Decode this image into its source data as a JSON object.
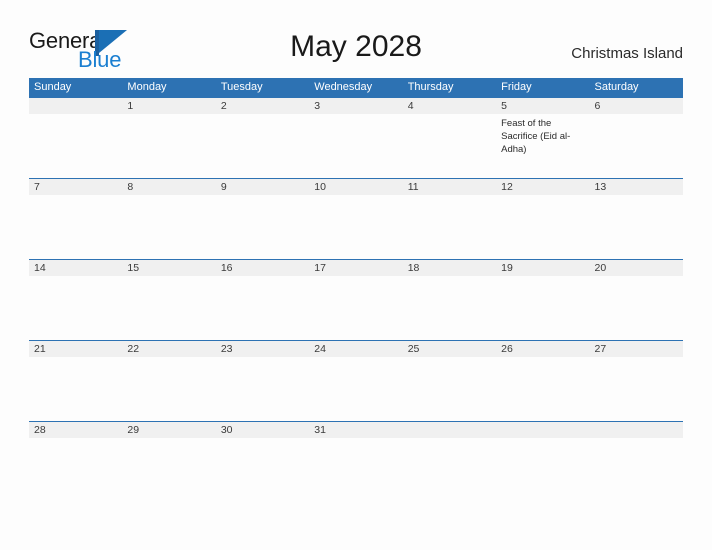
{
  "brand": {
    "name_part1": "General",
    "name_part2": "Blue",
    "mark": "triangle-flag-icon",
    "colors": {
      "dark_text": "#1a1a1a",
      "blue_text": "#1b7fd1",
      "bar": "#1b5f9e",
      "triangle": "#1b6fb5"
    }
  },
  "header": {
    "title": "May 2028",
    "location": "Christmas Island"
  },
  "calendar": {
    "colors": {
      "header_blue": "#2d72b3",
      "row_divider_blue": "#2d72b3",
      "date_strip_gray": "#f0f0f0",
      "page_background": "#fdfdfd"
    },
    "weekdays": [
      "Sunday",
      "Monday",
      "Tuesday",
      "Wednesday",
      "Thursday",
      "Friday",
      "Saturday"
    ],
    "weeks": [
      [
        {
          "date": "",
          "event": ""
        },
        {
          "date": "1",
          "event": ""
        },
        {
          "date": "2",
          "event": ""
        },
        {
          "date": "3",
          "event": ""
        },
        {
          "date": "4",
          "event": ""
        },
        {
          "date": "5",
          "event": "Feast of the Sacrifice (Eid al-Adha)"
        },
        {
          "date": "6",
          "event": ""
        }
      ],
      [
        {
          "date": "7",
          "event": ""
        },
        {
          "date": "8",
          "event": ""
        },
        {
          "date": "9",
          "event": ""
        },
        {
          "date": "10",
          "event": ""
        },
        {
          "date": "11",
          "event": ""
        },
        {
          "date": "12",
          "event": ""
        },
        {
          "date": "13",
          "event": ""
        }
      ],
      [
        {
          "date": "14",
          "event": ""
        },
        {
          "date": "15",
          "event": ""
        },
        {
          "date": "16",
          "event": ""
        },
        {
          "date": "17",
          "event": ""
        },
        {
          "date": "18",
          "event": ""
        },
        {
          "date": "19",
          "event": ""
        },
        {
          "date": "20",
          "event": ""
        }
      ],
      [
        {
          "date": "21",
          "event": ""
        },
        {
          "date": "22",
          "event": ""
        },
        {
          "date": "23",
          "event": ""
        },
        {
          "date": "24",
          "event": ""
        },
        {
          "date": "25",
          "event": ""
        },
        {
          "date": "26",
          "event": ""
        },
        {
          "date": "27",
          "event": ""
        }
      ],
      [
        {
          "date": "28",
          "event": ""
        },
        {
          "date": "29",
          "event": ""
        },
        {
          "date": "30",
          "event": ""
        },
        {
          "date": "31",
          "event": ""
        },
        {
          "date": "",
          "event": ""
        },
        {
          "date": "",
          "event": ""
        },
        {
          "date": "",
          "event": ""
        }
      ]
    ]
  }
}
